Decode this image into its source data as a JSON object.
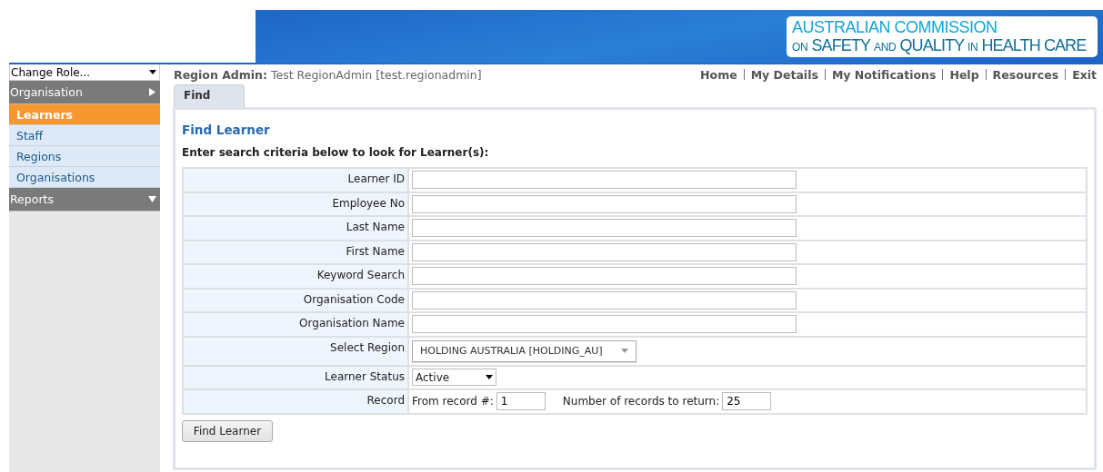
{
  "logo": {
    "line1": "AUSTRALIAN COMMISSION",
    "line2": [
      {
        "text": "ON",
        "small": true
      },
      {
        "text": "SAFETY",
        "small": false
      },
      {
        "text": "AND",
        "small": true
      },
      {
        "text": "QUALITY",
        "small": false
      },
      {
        "text": "IN",
        "small": true
      },
      {
        "text": "HEALTH CARE",
        "small": false
      }
    ]
  },
  "sidebar": {
    "role_select": "Change Role...",
    "sections": [
      {
        "label": "Organisation",
        "expanded": false,
        "items": [
          {
            "label": "Learners",
            "selected": true
          },
          {
            "label": "Staff",
            "selected": false
          },
          {
            "label": "Regions",
            "selected": false
          },
          {
            "label": "Organisations",
            "selected": false
          }
        ]
      },
      {
        "label": "Reports",
        "expanded": true
      }
    ]
  },
  "user": {
    "role": "Region Admin:",
    "name": "Test RegionAdmin [test.regionadmin]"
  },
  "nav": [
    "Home",
    "My Details",
    "My Notifications",
    "Help",
    "Resources",
    "Exit"
  ],
  "tabs": [
    {
      "label": "Find",
      "selected": true
    }
  ],
  "form": {
    "title": "Find Learner",
    "instruction": "Enter search criteria below to look for Learner(s):",
    "rows": [
      {
        "kind": "text",
        "label": "Learner ID"
      },
      {
        "kind": "text",
        "label": "Employee No"
      },
      {
        "kind": "text",
        "label": "Last Name"
      },
      {
        "kind": "text",
        "label": "First Name"
      },
      {
        "kind": "text",
        "label": "Keyword Search"
      },
      {
        "kind": "text",
        "label": "Organisation Code"
      },
      {
        "kind": "text",
        "label": "Organisation Name"
      },
      {
        "kind": "combo",
        "label": "Select Region",
        "value": "HOLDING AUSTRALIA [HOLDING_AU]"
      },
      {
        "kind": "select",
        "label": "Learner Status",
        "value": "Active"
      },
      {
        "kind": "record",
        "label": "Record",
        "from_label": "From record #:",
        "from_value": "1",
        "count_label": "Number of records to return:",
        "count_value": "25"
      }
    ],
    "button": "Find Learner"
  }
}
